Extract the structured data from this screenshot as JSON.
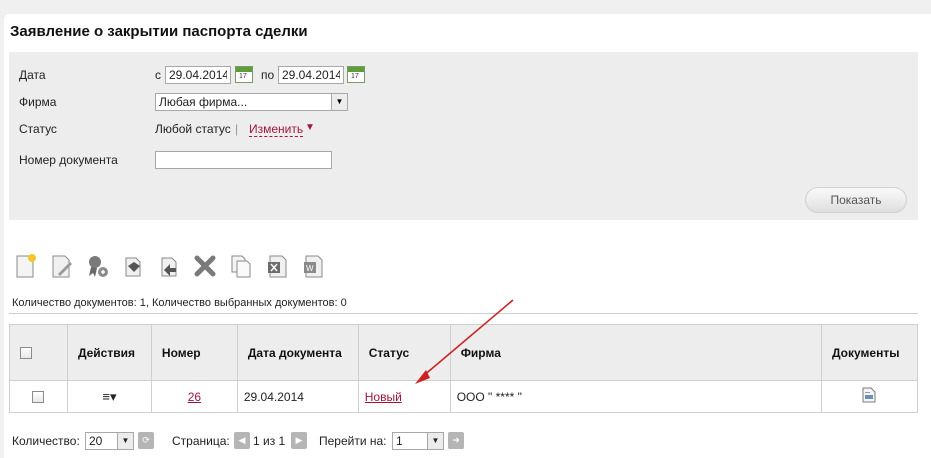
{
  "page": {
    "title": "Заявление о закрытии паспорта сделки"
  },
  "filters": {
    "date_label": "Дата",
    "from_prefix": "с",
    "date_from": "29.04.2014",
    "to_prefix": "по",
    "date_to": "29.04.2014",
    "firm_label": "Фирма",
    "firm_value": "Любая фирма...",
    "status_label": "Статус",
    "status_value": "Любой статус",
    "status_divider": "|",
    "status_change": "Изменить",
    "status_change_arrow": "▼",
    "doc_number_label": "Номер документа",
    "doc_number_value": "",
    "show_button": "Показать"
  },
  "toolbar": {
    "icons": [
      "new-document-icon",
      "edit-document-icon",
      "certificate-add-icon",
      "sign-icon",
      "unsign-icon",
      "delete-icon",
      "copy-icon",
      "export-excel-icon",
      "export-word-icon"
    ]
  },
  "summary": "Количество документов: 1, Количество выбранных документов: 0",
  "table": {
    "headers": {
      "actions": "Действия",
      "number": "Номер",
      "date": "Дата документа",
      "status": "Статус",
      "firm": "Фирма",
      "documents": "Документы"
    },
    "rows": [
      {
        "actions_icon": "≡▾",
        "number": "26",
        "date": "29.04.2014",
        "status": "Новый",
        "firm": "ООО \" **** \""
      }
    ]
  },
  "pager": {
    "count_label": "Количество:",
    "count_value": "20",
    "page_label": "Страница:",
    "page_info": "1 из 1",
    "goto_label": "Перейти на:",
    "goto_value": "1"
  },
  "colors": {
    "accent_link": "#a3163a",
    "arrow": "#cc2222",
    "panel": "#ededed"
  }
}
